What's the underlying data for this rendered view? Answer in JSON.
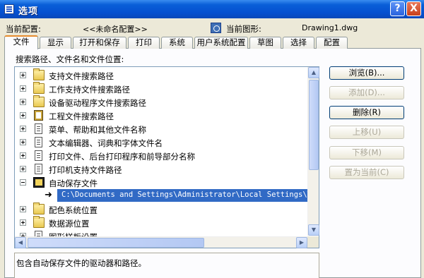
{
  "window": {
    "title": "选项",
    "help_glyph": "?",
    "close_glyph": "X"
  },
  "config": {
    "current_profile_label": "当前配置:",
    "current_profile_value": "<<未命名配置>>",
    "current_drawing_label": "当前图形:",
    "current_drawing_value": "Drawing1.dwg"
  },
  "tabs": [
    {
      "label": "文件",
      "active": true
    },
    {
      "label": "显示"
    },
    {
      "label": "打开和保存"
    },
    {
      "label": "打印"
    },
    {
      "label": "系统"
    },
    {
      "label": "用户系统配置"
    },
    {
      "label": "草图"
    },
    {
      "label": "选择"
    },
    {
      "label": "配置"
    }
  ],
  "section_label": "搜索路径、文件名和文件位置:",
  "tree": {
    "items": [
      {
        "label": "支持文件搜索路径",
        "icon": "folder-icon",
        "expander": "plus"
      },
      {
        "label": "工作支持文件搜索路径",
        "icon": "folder-icon",
        "expander": "plus"
      },
      {
        "label": "设备驱动程序文件搜索路径",
        "icon": "folder-icon",
        "expander": "plus"
      },
      {
        "label": "工程文件搜索路径",
        "icon": "project-icon",
        "expander": "plus"
      },
      {
        "label": "菜单、帮助和其他文件名称",
        "icon": "document-icon",
        "expander": "plus"
      },
      {
        "label": "文本编辑器、词典和字体文件名",
        "icon": "document-icon",
        "expander": "plus"
      },
      {
        "label": "打印文件、后台打印程序和前导部分名称",
        "icon": "document-icon",
        "expander": "plus"
      },
      {
        "label": "打印机支持文件路径",
        "icon": "document-icon",
        "expander": "plus"
      },
      {
        "label": "自动保存文件",
        "icon": "folder-icon",
        "expander": "minus"
      },
      {
        "label": "配色系统位置",
        "icon": "folder-icon",
        "expander": "plus"
      },
      {
        "label": "数据源位置",
        "icon": "folder-icon",
        "expander": "plus"
      },
      {
        "label": "图形样板设置",
        "icon": "document-icon",
        "expander": "plus"
      }
    ],
    "selected_subitem": "C:\\Documents and Settings\\Administrator\\Local Settings\\Temp\\"
  },
  "buttons": {
    "browse": "浏览(B)...",
    "add": "添加(D)...",
    "remove": "删除(R)",
    "move_up": "上移(U)",
    "move_down": "下移(M)",
    "set_current": "置为当前(C)"
  },
  "description": "包含自动保存文件的驱动器和路径。",
  "colors": {
    "titlebar": "#0550d0",
    "selection": "#316ac5",
    "active_tab_accent": "#e68b2c"
  }
}
